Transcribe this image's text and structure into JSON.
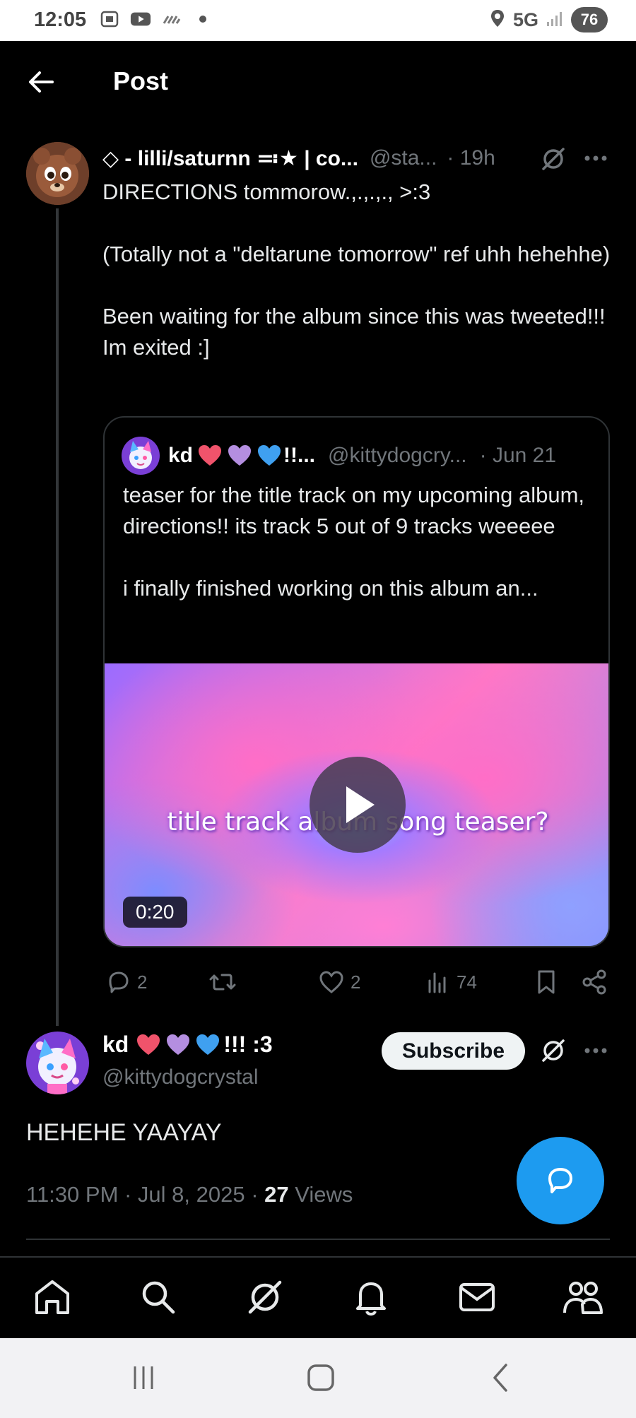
{
  "status_bar": {
    "time": "12:05",
    "network": "5G",
    "battery": "76",
    "icons": [
      "screenshot-icon",
      "youtube-icon",
      "wifi-off-icon",
      "dot-icon",
      "location-icon",
      "signal-icon"
    ]
  },
  "header": {
    "title": "Post"
  },
  "post": {
    "author_name": "◇ - lilli/saturnn ≕★ | co...",
    "handle": "@sta...",
    "time": "· 19h",
    "body": [
      "DIRECTIONS tommorow.,.,.,., >:3",
      "",
      "(Totally not a \"deltarune tomorrow\" ref uhh hehehhe)",
      "",
      "Been waiting for the album since this was tweeted!!! Im exited :]"
    ],
    "quote": {
      "author_name": "kd",
      "author_suffix": "!!...",
      "handle": "@kittydogcry...",
      "time": "· Jun 21",
      "body": [
        "teaser for the title track on my upcoming album, directions!! its track 5 out of 9 tracks weeeee",
        "",
        " i finally finished working on this album an..."
      ],
      "video": {
        "caption": "title track album song teaser?",
        "duration": "0:20"
      }
    },
    "actions": {
      "replies": "2",
      "reposts": "",
      "likes": "2",
      "views": "74"
    }
  },
  "reply": {
    "author_name": "kd",
    "author_suffix": "!!! :3",
    "handle": "@kittydogcrystal",
    "subscribe_label": "Subscribe",
    "text": "HEHEHE YAAYAY",
    "timestamp": "11:30 PM · Jul 8, 2025 · ",
    "views_count": "27",
    "views_label": " Views"
  },
  "bottom_nav": {
    "items": [
      "home-icon",
      "search-icon",
      "grok-icon",
      "notifications-icon",
      "messages-icon",
      "communities-icon"
    ]
  },
  "colors": {
    "accent": "#1d9bf0",
    "background": "#000000",
    "muted_text": "#71767b",
    "heart_red": "#f0536b",
    "heart_purple": "#b48ee0",
    "heart_blue": "#3fa0f0"
  }
}
